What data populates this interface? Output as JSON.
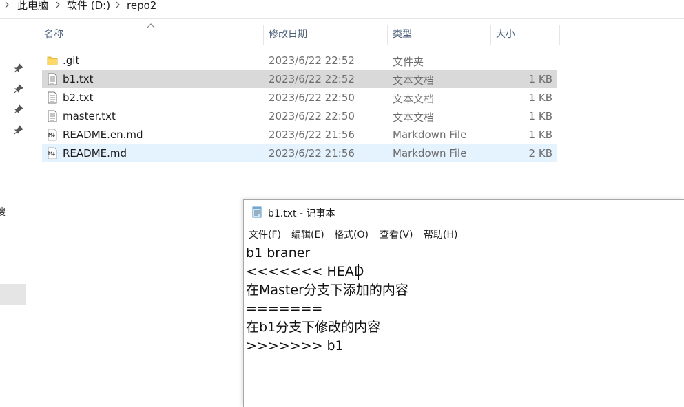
{
  "address_bar": {
    "crumbs": [
      "此电脑",
      "软件 (D:)",
      "repo2"
    ]
  },
  "columns": {
    "name": "名称",
    "date": "修改日期",
    "type": "类型",
    "size": "大小"
  },
  "files": [
    {
      "name": ".git",
      "date": "2023/6/22 22:52",
      "type": "文件夹",
      "size": "",
      "icon": "folder-icon"
    },
    {
      "name": "b1.txt",
      "date": "2023/6/22 22:52",
      "type": "文本文档",
      "size": "1 KB",
      "icon": "text-file-icon"
    },
    {
      "name": "b2.txt",
      "date": "2023/6/22 22:50",
      "type": "文本文档",
      "size": "1 KB",
      "icon": "text-file-icon"
    },
    {
      "name": "master.txt",
      "date": "2023/6/22 22:50",
      "type": "文本文档",
      "size": "1 KB",
      "icon": "text-file-icon"
    },
    {
      "name": "README.en.md",
      "date": "2023/6/22 21:56",
      "type": "Markdown File",
      "size": "1 KB",
      "icon": "markdown-file-icon"
    },
    {
      "name": "README.md",
      "date": "2023/6/22 21:56",
      "type": "Markdown File",
      "size": "2 KB",
      "icon": "markdown-file-icon"
    }
  ],
  "nav": {
    "cut_text": "搜"
  },
  "notepad": {
    "title": "b1.txt - 记事本",
    "menu": [
      "文件(F)",
      "编辑(E)",
      "格式(O)",
      "查看(V)",
      "帮助(H)"
    ],
    "lines": [
      "b1 braner",
      "<<<<<<< HEAD",
      "在Master分支下添加的内容",
      "=======",
      "在b1分支下修改的内容",
      ">>>>>>> b1"
    ]
  },
  "colors": {
    "selected_row": "#d9d9d9",
    "hover_row": "#e5f3ff",
    "header_text": "#4c607a",
    "folder": "#f3c94a"
  }
}
